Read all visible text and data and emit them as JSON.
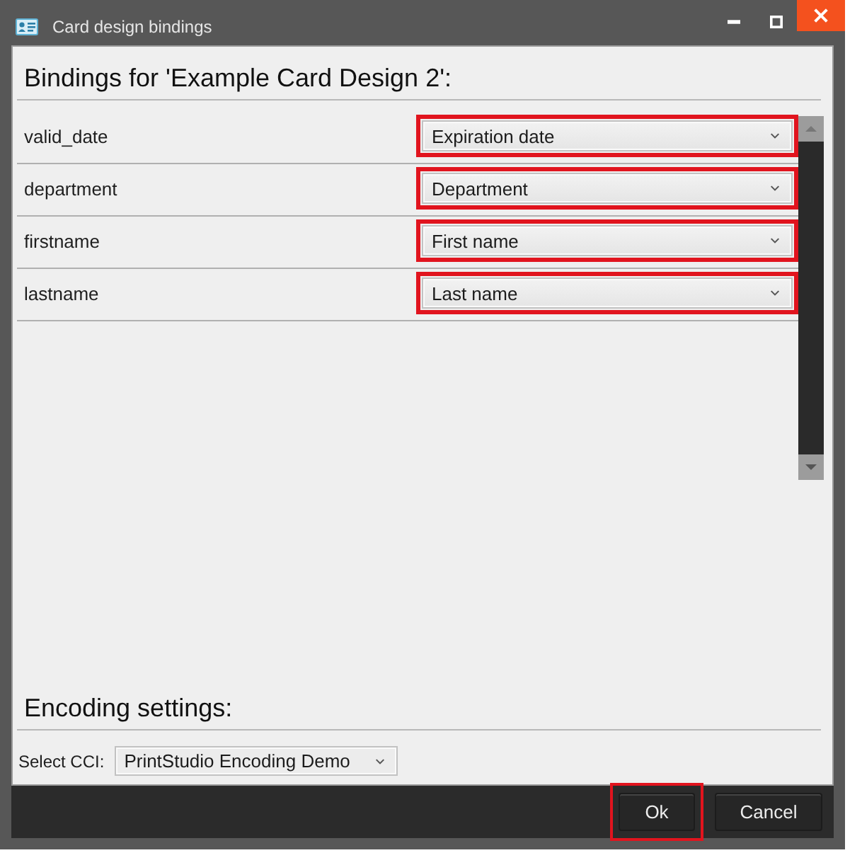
{
  "window": {
    "title": "Card design bindings"
  },
  "bindings_heading": "Bindings for 'Example Card Design 2':",
  "bindings": [
    {
      "field": "valid_date",
      "value": "Expiration date",
      "highlighted": true
    },
    {
      "field": "department",
      "value": "Department",
      "highlighted": true
    },
    {
      "field": "firstname",
      "value": "First name",
      "highlighted": true
    },
    {
      "field": "lastname",
      "value": "Last name",
      "highlighted": true
    }
  ],
  "encoding": {
    "heading": "Encoding settings:",
    "label": "Select CCI:",
    "value": "PrintStudio Encoding Demo"
  },
  "buttons": [
    {
      "label": "Ok",
      "highlighted": true
    },
    {
      "label": "Cancel",
      "highlighted": false
    }
  ]
}
